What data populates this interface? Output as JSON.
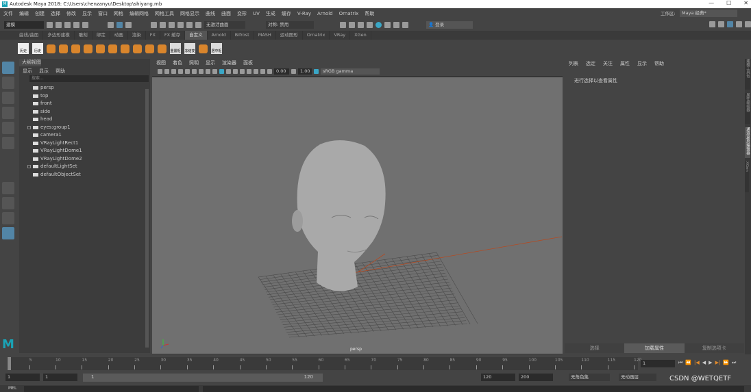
{
  "title": "Autodesk Maya 2018: C:\\Users\\chenzanyu\\Desktop\\shiyang.mb",
  "menus": [
    "文件",
    "编辑",
    "创建",
    "选择",
    "修改",
    "显示",
    "窗口",
    "网格",
    "编辑网格",
    "网格工具",
    "网格显示",
    "曲线",
    "曲面",
    "变形",
    "UV",
    "生成",
    "缓存",
    "V-Ray",
    "Arnold",
    "Ornatrix",
    "帮助"
  ],
  "status": {
    "mode": "建模",
    "live_surface": "无激活曲面",
    "symmetry": "对称: 禁用",
    "login": "登录",
    "workspace_label": "工作区:",
    "workspace": "Maya 经典*"
  },
  "shelf_tabs": [
    "曲线/曲面",
    "多边形建模",
    "雕刻",
    "绑定",
    "动画",
    "渲染",
    "FX",
    "FX 缓存",
    "自定义",
    "Arnold",
    "Bifrost",
    "MASH",
    "运动图形",
    "Ornatrix",
    "VRay",
    "XGen"
  ],
  "shelf_labels": [
    "历史",
    "历史",
    "重置枢",
    "冻结变",
    "居中枢"
  ],
  "outliner": {
    "tab": "大纲视图",
    "menu": [
      "显示",
      "显示",
      "帮助"
    ],
    "search_placeholder": "搜索...",
    "items": [
      {
        "name": "persp",
        "indent": 0
      },
      {
        "name": "top",
        "indent": 0
      },
      {
        "name": "front",
        "indent": 0
      },
      {
        "name": "side",
        "indent": 0
      },
      {
        "name": "head",
        "indent": 0
      },
      {
        "name": "eyes:group1",
        "expand": true
      },
      {
        "name": "camera1"
      },
      {
        "name": "VRayLightRect1"
      },
      {
        "name": "VRayLightDome1"
      },
      {
        "name": "VRayLightDome2"
      },
      {
        "name": "defaultLightSet",
        "expand": true
      },
      {
        "name": "defaultObjectSet"
      }
    ]
  },
  "viewport": {
    "menu": [
      "视图",
      "着色",
      "照明",
      "显示",
      "渲染器",
      "面板"
    ],
    "exposure": "0.00",
    "gamma": "1.00",
    "colorspace": "sRGB gamma",
    "camera": "persp"
  },
  "attr": {
    "menu": [
      "列表",
      "选定",
      "关注",
      "属性",
      "显示",
      "帮助"
    ],
    "hint": "进行选择以查看属性",
    "buttons": [
      "选择",
      "加载属性",
      "复制选项卡"
    ]
  },
  "side_tabs": [
    "建模工具包",
    "属性编辑器",
    "通道盒/层编辑器",
    "XGen"
  ],
  "timeline": {
    "ticks": [
      "1",
      "5",
      "10",
      "15",
      "20",
      "25",
      "30",
      "35",
      "40",
      "45",
      "50",
      "55",
      "60",
      "65",
      "70",
      "75",
      "80",
      "85",
      "90",
      "95",
      "100",
      "105",
      "110",
      "115",
      "120"
    ],
    "current": "1"
  },
  "range": {
    "start": "1",
    "play_start": "1",
    "slider_start": "1",
    "slider_end": "120",
    "play_end": "120",
    "end": "200",
    "char_set": "无角色集",
    "anim_layer": "无动画层"
  },
  "cmd": {
    "label": "MEL"
  },
  "watermark": "CSDN @WETQETF"
}
